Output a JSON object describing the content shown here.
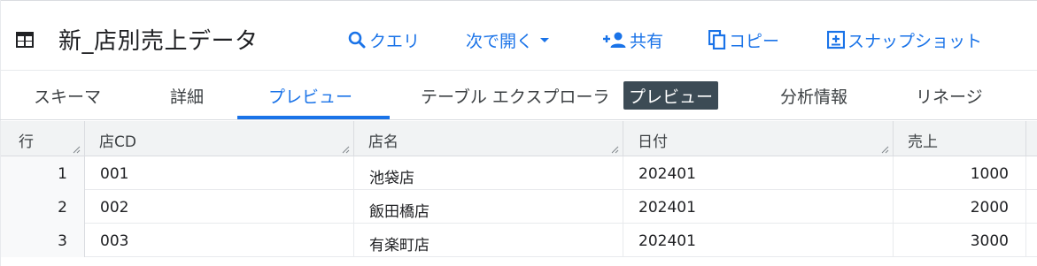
{
  "header": {
    "title": "新_店別売上データ",
    "actions": [
      {
        "label": "クエリ",
        "icon": "search-icon"
      },
      {
        "label": "次で開く",
        "icon": "dropdown-arrow-icon"
      },
      {
        "label": "共有",
        "icon": "person-add-icon"
      },
      {
        "label": "コピー",
        "icon": "copy-icon"
      },
      {
        "label": "スナップショット",
        "icon": "snapshot-icon"
      }
    ]
  },
  "tabs": [
    {
      "label": "スキーマ"
    },
    {
      "label": "詳細"
    },
    {
      "label": "プレビュー",
      "active": true
    },
    {
      "label": "テーブル エクスプローラ"
    },
    {
      "label": "分析情報"
    },
    {
      "label": "リネージ"
    }
  ],
  "badge": "プレビュー",
  "grid": {
    "columns": [
      "行",
      "店CD",
      "店名",
      "日付",
      "売上"
    ],
    "rows": [
      {
        "row": "1",
        "store_cd": "001",
        "store_name": "池袋店",
        "date": "202401",
        "sales": "1000"
      },
      {
        "row": "2",
        "store_cd": "002",
        "store_name": "飯田橋店",
        "date": "202401",
        "sales": "2000"
      },
      {
        "row": "3",
        "store_cd": "003",
        "store_name": "有楽町店",
        "date": "202401",
        "sales": "3000"
      }
    ]
  },
  "colors": {
    "accent": "#1a73e8",
    "badge_bg": "#3c4b55",
    "header_bg": "#f1f3f4"
  }
}
